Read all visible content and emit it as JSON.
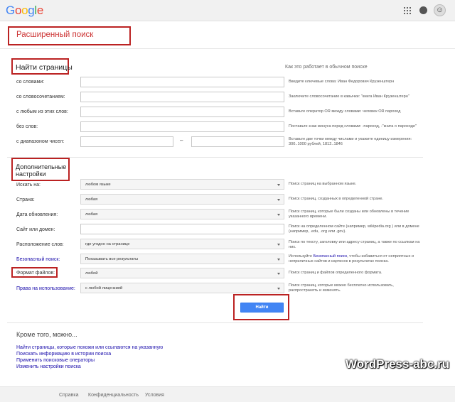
{
  "header": {
    "logo_letters": [
      {
        "ch": "G",
        "color": "#4285f4"
      },
      {
        "ch": "o",
        "color": "#ea4335"
      },
      {
        "ch": "o",
        "color": "#fbbc05"
      },
      {
        "ch": "g",
        "color": "#4285f4"
      },
      {
        "ch": "l",
        "color": "#34a853"
      },
      {
        "ch": "e",
        "color": "#ea4335"
      }
    ],
    "icons": [
      "apps-grid-icon",
      "notifications-icon",
      "account-avatar"
    ]
  },
  "page_title": "Расширенный поиск",
  "find_pages": {
    "title": "Найти страницы",
    "howto": "Как это работает в обычном поиске",
    "rows": [
      {
        "label": "со словами:",
        "hint": "Введите ключевые слова: Иван Федорович Крузенштерн"
      },
      {
        "label": "со словосочетанием:",
        "hint": "Заключите словосочетание в кавычки: \"книга Иван Крузенштерн\""
      },
      {
        "label": "с любым из этих слов:",
        "hint": "Вставьте оператор OR между словами: человек OR пароход"
      },
      {
        "label": "без слов:",
        "hint": "Поставьте знак минуса перед словами: -пароход, -\"книга о пароходе\""
      },
      {
        "label": "с диапазоном чисел:",
        "hint": "Вставьте две точки между числами и укажите единицу измерения: 300..1000 рублей, 1812..1846"
      }
    ],
    "range_dash": "–"
  },
  "extra": {
    "title": "Дополнительные настройки",
    "rows": [
      {
        "label": "Искать на:",
        "value": "любом языке",
        "hint": "Поиск страниц на выбранном языке.",
        "link": false
      },
      {
        "label": "Страна:",
        "value": "любая",
        "hint": "Поиск страниц, созданных в определенной стране.",
        "link": false
      },
      {
        "label": "Дата обновления:",
        "value": "любая",
        "hint": "Поиск страниц, которые были созданы или обновлены в течение указанного времени.",
        "link": false
      },
      {
        "label": "Сайт или домен:",
        "value": "",
        "hint": "Поиск на определенном сайте (например, wikipedia.org ) или в домене (например, .edu, .org или .gov).",
        "link": false
      },
      {
        "label": "Расположение слов:",
        "value": "где угодно на странице",
        "hint": "Поиск по тексту, заголовку или адресу страниц, а также по ссылкам на них.",
        "link": false
      },
      {
        "label": "Безопасный поиск:",
        "value": "Показывать все результаты",
        "hint_prefix": "Используйте ",
        "hint_link": "Безопасный поиск",
        "hint_suffix": ", чтобы избавиться от неприятных и неприличных сайтов и картинок в результатах поиска.",
        "link": true
      },
      {
        "label": "Формат файлов:",
        "value": "любой",
        "hint": "Поиск страниц и файлов определенного формата.",
        "link": false
      },
      {
        "label": "Права на использование:",
        "value": "с любой лицензией",
        "hint": "Поиск страниц, которые можно бесплатно использовать, распространять и изменять.",
        "link": true
      }
    ]
  },
  "find_button": "Найти",
  "more": {
    "title": "Кроме того, можно...",
    "links": [
      "Найти страницы, которые похожи или ссылаются на указанную",
      "Поискать информацию в истории поиска",
      "Применить поисковые операторы",
      "Изменить настройки поиска"
    ]
  },
  "watermark": "WordPress-abc.ru",
  "footer": {
    "links": [
      "Справка",
      "Конфиденциальность",
      "Условия"
    ]
  },
  "colors": {
    "highlight_box": "#b22222",
    "link": "#1a0dab",
    "button": "#4285f4"
  }
}
